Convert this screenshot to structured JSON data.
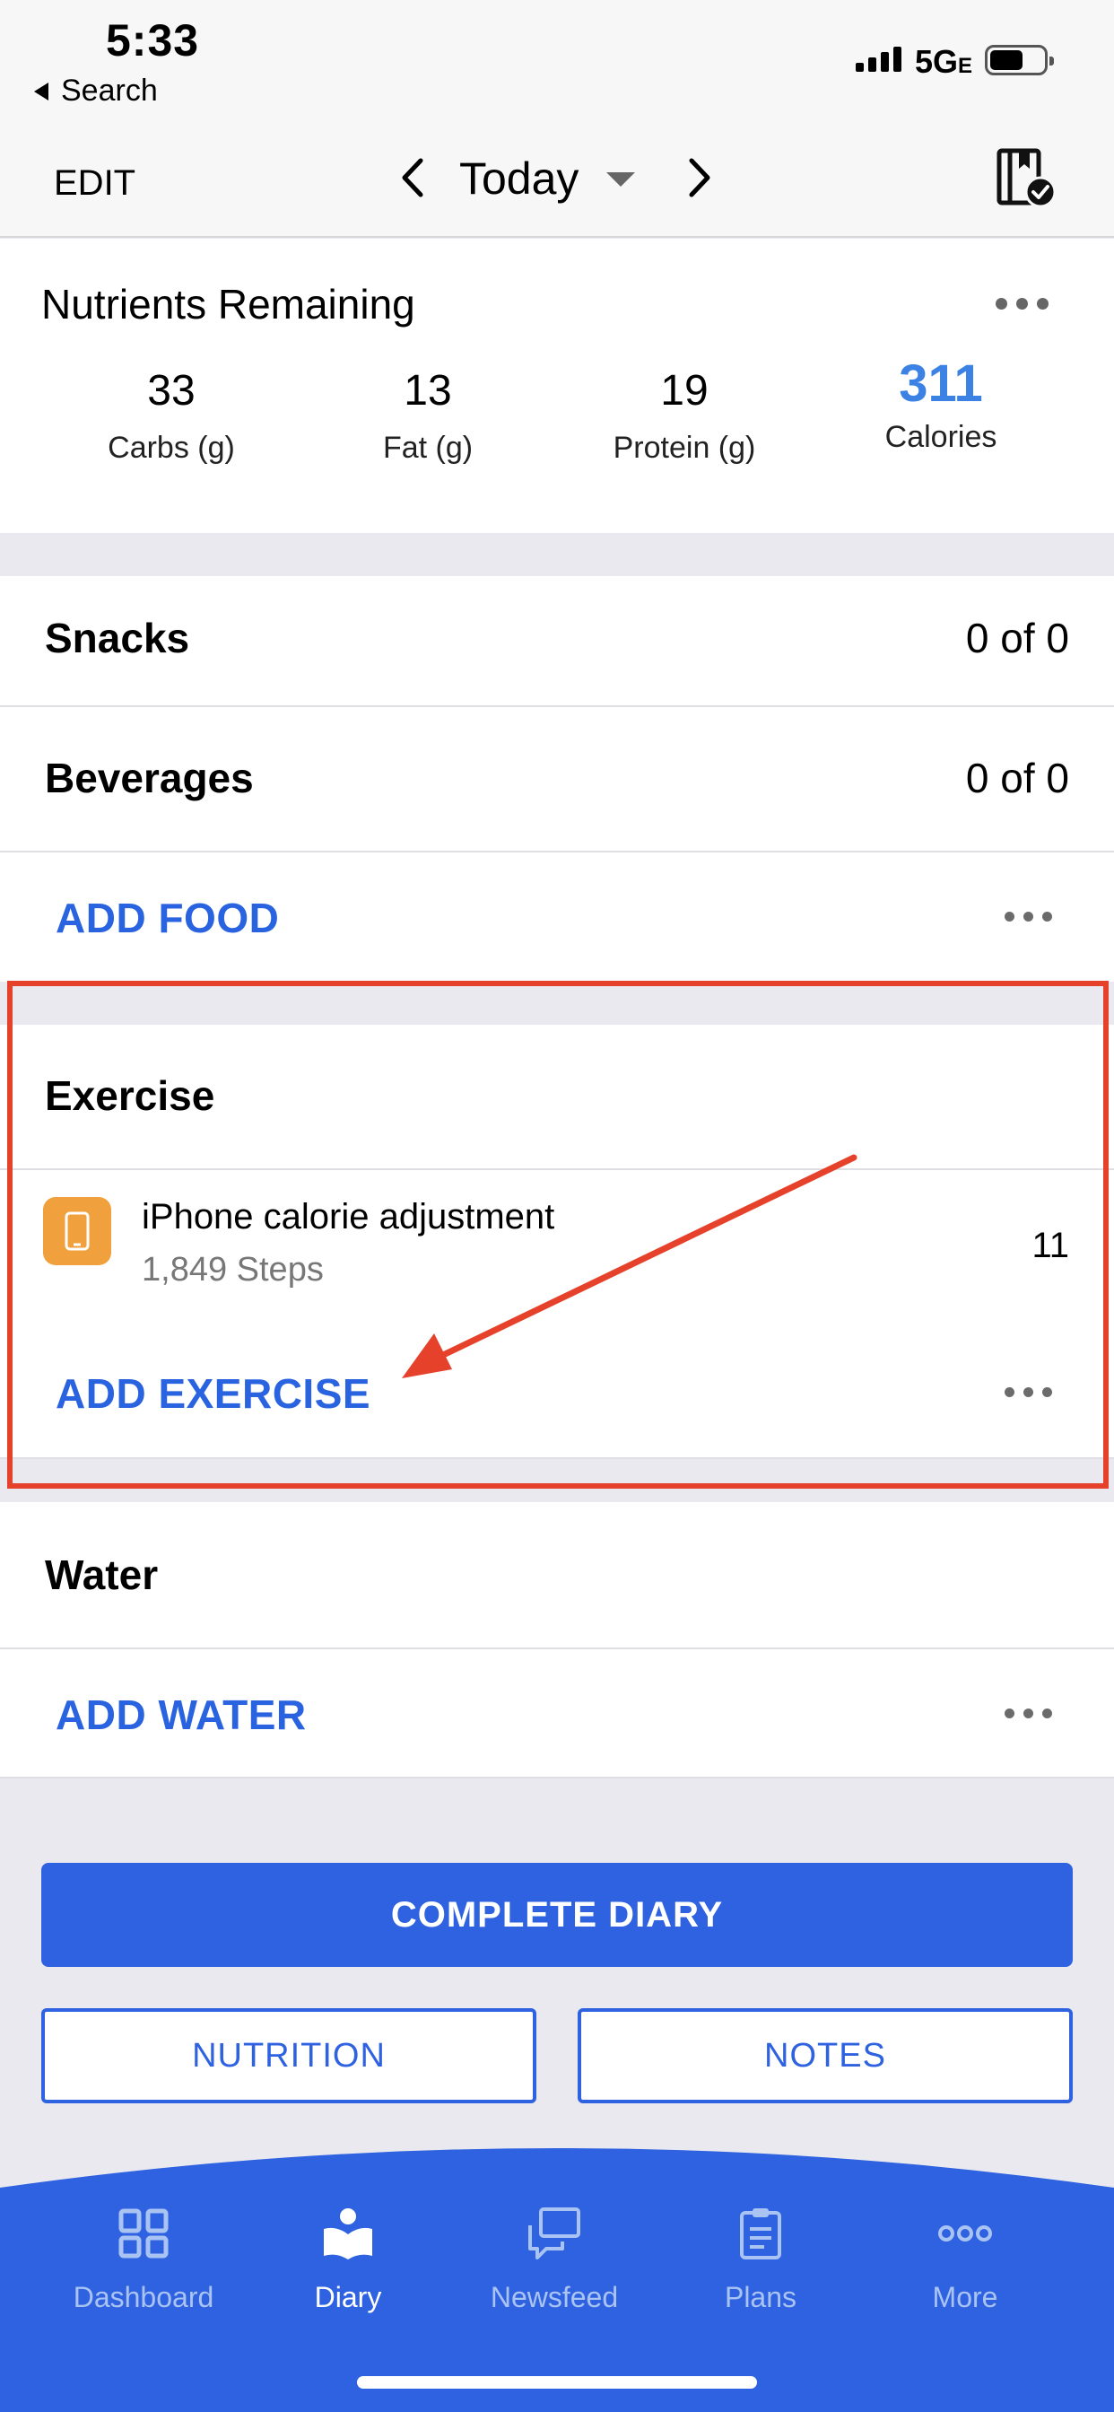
{
  "status_bar": {
    "time": "5:33",
    "back_label": "Search",
    "network": "5G",
    "network_suffix": "E"
  },
  "nav": {
    "edit_label": "EDIT",
    "date_label": "Today"
  },
  "nutrients": {
    "title": "Nutrients Remaining",
    "items": [
      {
        "value": "33",
        "label": "Carbs (g)"
      },
      {
        "value": "13",
        "label": "Fat (g)"
      },
      {
        "value": "19",
        "label": "Protein (g)"
      },
      {
        "value": "311",
        "label": "Calories"
      }
    ]
  },
  "meals": [
    {
      "title": "Snacks",
      "value": "0 of 0"
    },
    {
      "title": "Beverages",
      "value": "0 of 0"
    }
  ],
  "add_food_label": "ADD FOOD",
  "exercise": {
    "title": "Exercise",
    "item": {
      "name": "iPhone calorie adjustment",
      "sub": "1,849 Steps",
      "calories": "11"
    },
    "add_label": "ADD EXERCISE"
  },
  "water": {
    "title": "Water",
    "add_label": "ADD WATER"
  },
  "buttons": {
    "complete": "COMPLETE DIARY",
    "nutrition": "NUTRITION",
    "notes": "NOTES"
  },
  "tabs": [
    {
      "label": "Dashboard"
    },
    {
      "label": "Diary"
    },
    {
      "label": "Newsfeed"
    },
    {
      "label": "Plans"
    },
    {
      "label": "More"
    }
  ],
  "colors": {
    "accent": "#2f62e0",
    "calories": "#3b82e4",
    "annotation": "#e6412b",
    "exercise_icon": "#f0a03c"
  }
}
